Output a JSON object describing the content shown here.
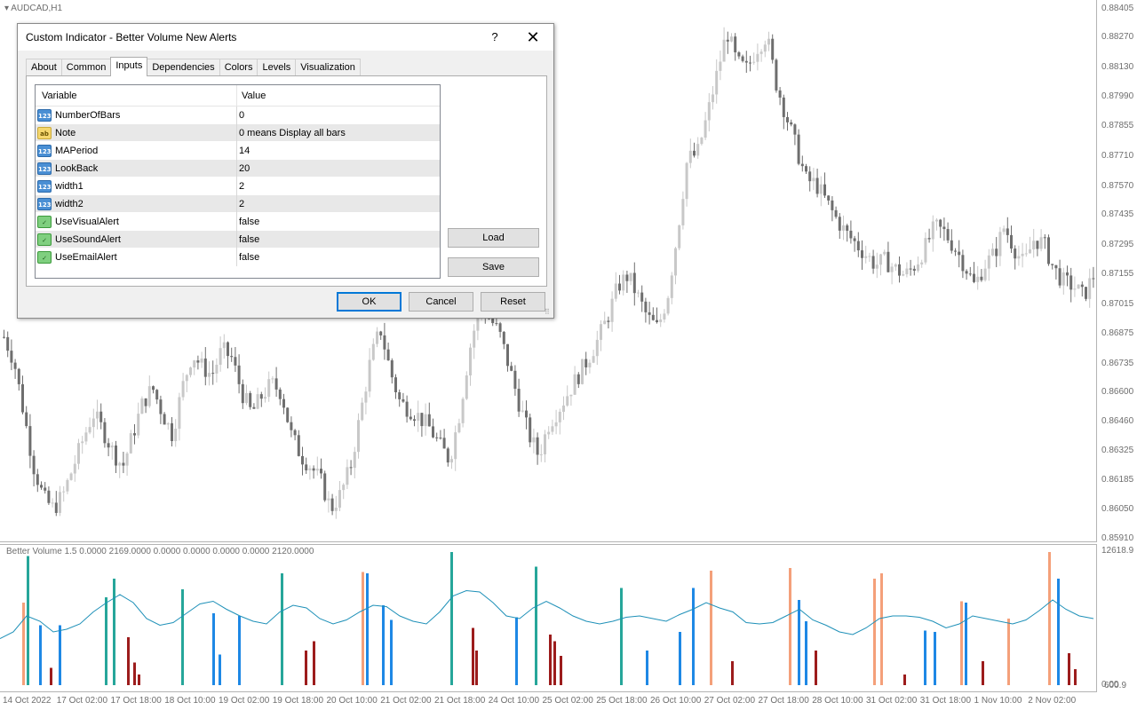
{
  "chart": {
    "symbol": "AUDCAD,H1",
    "bull_color": "#c8c8c8",
    "bear_color": "#6e6e6e",
    "price_ticks": [
      "0.88405",
      "0.88270",
      "0.88130",
      "0.87990",
      "0.87855",
      "0.87710",
      "0.87570",
      "0.87435",
      "0.87295",
      "0.87155",
      "0.87015",
      "0.86875",
      "0.86735",
      "0.86600",
      "0.86460",
      "0.86325",
      "0.86185",
      "0.86050",
      "0.85910"
    ],
    "time_ticks": [
      "14 Oct 2022",
      "17 Oct 02:00",
      "17 Oct 18:00",
      "18 Oct 10:00",
      "19 Oct 02:00",
      "19 Oct 18:00",
      "20 Oct 10:00",
      "21 Oct 02:00",
      "21 Oct 18:00",
      "24 Oct 10:00",
      "25 Oct 02:00",
      "25 Oct 18:00",
      "26 Oct 10:00",
      "27 Oct 02:00",
      "27 Oct 18:00",
      "28 Oct 10:00",
      "31 Oct 02:00",
      "31 Oct 18:00",
      "1 Nov 10:00",
      "2 Nov 02:00"
    ],
    "candle_path": [
      0.8686,
      0.8675,
      0.865,
      0.8625,
      0.861,
      0.8605,
      0.8612,
      0.8625,
      0.8638,
      0.865,
      0.8642,
      0.8632,
      0.8625,
      0.864,
      0.8655,
      0.8662,
      0.865,
      0.864,
      0.8662,
      0.8678,
      0.8672,
      0.8668,
      0.868,
      0.8676,
      0.866,
      0.865,
      0.8658,
      0.8664,
      0.866,
      0.864,
      0.863,
      0.8625,
      0.8618,
      0.8605,
      0.8612,
      0.8625,
      0.865,
      0.8675,
      0.869,
      0.867,
      0.8655,
      0.8652,
      0.8648,
      0.8643,
      0.8635,
      0.8628,
      0.865,
      0.868,
      0.87,
      0.8695,
      0.8688,
      0.8672,
      0.8655,
      0.864,
      0.863,
      0.8645,
      0.8652,
      0.866,
      0.8668,
      0.8676,
      0.8685,
      0.8696,
      0.871,
      0.8715,
      0.8705,
      0.8695,
      0.869,
      0.8705,
      0.8735,
      0.877,
      0.8772,
      0.879,
      0.881,
      0.883,
      0.8815,
      0.8812,
      0.8822,
      0.8828,
      0.8805,
      0.879,
      0.8775,
      0.876,
      0.8758,
      0.875,
      0.8742,
      0.8735,
      0.873,
      0.8725,
      0.872,
      0.8722,
      0.8718,
      0.8715,
      0.872,
      0.8728,
      0.8738,
      0.8735,
      0.8728,
      0.872,
      0.871,
      0.872,
      0.8725,
      0.8738,
      0.8728,
      0.872,
      0.8732,
      0.873,
      0.8718,
      0.8712,
      0.871,
      0.8705,
      0.8715
    ]
  },
  "indicator": {
    "label": "Better Volume 1.5 0.0000 2169.0000 0.0000 0.0000 0.0000 0.0000 2120.0000",
    "max_label": "12618.9",
    "zero_label": "0.00",
    "zero_label_2": "600.9",
    "colors": {
      "climax": "#26a69a",
      "churn": "#f4a07a",
      "lowvol": "#1e88e5",
      "high": "#9c1c1c",
      "ma": "#1e90b8"
    },
    "bars": [
      [
        25,
        "churn",
        0.62
      ],
      [
        30,
        "climax",
        0.97
      ],
      [
        44,
        "lowvol",
        0.45
      ],
      [
        56,
        "high",
        0.13
      ],
      [
        66,
        "lowvol",
        0.45
      ],
      [
        118,
        "climax",
        0.66
      ],
      [
        127,
        "climax",
        0.8
      ],
      [
        143,
        "high",
        0.36
      ],
      [
        150,
        "high",
        0.17
      ],
      [
        155,
        "high",
        0.08
      ],
      [
        204,
        "climax",
        0.72
      ],
      [
        239,
        "lowvol",
        0.54
      ],
      [
        246,
        "lowvol",
        0.23
      ],
      [
        268,
        "lowvol",
        0.52
      ],
      [
        316,
        "climax",
        0.84
      ],
      [
        343,
        "high",
        0.26
      ],
      [
        352,
        "high",
        0.33
      ],
      [
        407,
        "churn",
        0.85
      ],
      [
        412,
        "lowvol",
        0.84
      ],
      [
        430,
        "lowvol",
        0.6
      ],
      [
        439,
        "lowvol",
        0.49
      ],
      [
        507,
        "climax",
        1.0
      ],
      [
        531,
        "high",
        0.43
      ],
      [
        535,
        "high",
        0.26
      ],
      [
        580,
        "lowvol",
        0.51
      ],
      [
        602,
        "climax",
        0.89
      ],
      [
        618,
        "high",
        0.38
      ],
      [
        623,
        "high",
        0.33
      ],
      [
        630,
        "high",
        0.22
      ],
      [
        698,
        "climax",
        0.73
      ],
      [
        727,
        "lowvol",
        0.26
      ],
      [
        764,
        "lowvol",
        0.4
      ],
      [
        779,
        "lowvol",
        0.73
      ],
      [
        799,
        "churn",
        0.86
      ],
      [
        823,
        "high",
        0.18
      ],
      [
        888,
        "churn",
        0.88
      ],
      [
        898,
        "lowvol",
        0.64
      ],
      [
        906,
        "lowvol",
        0.48
      ],
      [
        917,
        "high",
        0.26
      ],
      [
        983,
        "churn",
        0.8
      ],
      [
        991,
        "churn",
        0.84
      ],
      [
        1017,
        "high",
        0.08
      ],
      [
        1040,
        "lowvol",
        0.41
      ],
      [
        1051,
        "lowvol",
        0.4
      ],
      [
        1081,
        "churn",
        0.63
      ],
      [
        1086,
        "lowvol",
        0.62
      ],
      [
        1105,
        "high",
        0.18
      ],
      [
        1134,
        "churn",
        0.5
      ],
      [
        1180,
        "churn",
        1.0
      ],
      [
        1190,
        "lowvol",
        0.8
      ],
      [
        1202,
        "high",
        0.24
      ],
      [
        1209,
        "high",
        0.12
      ]
    ],
    "ma_points": [
      [
        0,
        0.35
      ],
      [
        15,
        0.4
      ],
      [
        30,
        0.52
      ],
      [
        45,
        0.48
      ],
      [
        60,
        0.4
      ],
      [
        75,
        0.42
      ],
      [
        90,
        0.46
      ],
      [
        105,
        0.55
      ],
      [
        120,
        0.62
      ],
      [
        135,
        0.68
      ],
      [
        150,
        0.62
      ],
      [
        165,
        0.5
      ],
      [
        180,
        0.45
      ],
      [
        195,
        0.47
      ],
      [
        210,
        0.54
      ],
      [
        225,
        0.61
      ],
      [
        240,
        0.63
      ],
      [
        255,
        0.57
      ],
      [
        270,
        0.52
      ],
      [
        285,
        0.48
      ],
      [
        300,
        0.46
      ],
      [
        315,
        0.55
      ],
      [
        330,
        0.6
      ],
      [
        345,
        0.58
      ],
      [
        360,
        0.5
      ],
      [
        375,
        0.46
      ],
      [
        390,
        0.49
      ],
      [
        405,
        0.55
      ],
      [
        420,
        0.6
      ],
      [
        435,
        0.59
      ],
      [
        450,
        0.52
      ],
      [
        465,
        0.48
      ],
      [
        480,
        0.46
      ],
      [
        495,
        0.55
      ],
      [
        510,
        0.67
      ],
      [
        525,
        0.71
      ],
      [
        540,
        0.7
      ],
      [
        555,
        0.62
      ],
      [
        570,
        0.52
      ],
      [
        585,
        0.5
      ],
      [
        600,
        0.58
      ],
      [
        615,
        0.63
      ],
      [
        630,
        0.58
      ],
      [
        645,
        0.52
      ],
      [
        660,
        0.48
      ],
      [
        675,
        0.46
      ],
      [
        690,
        0.48
      ],
      [
        705,
        0.51
      ],
      [
        720,
        0.52
      ],
      [
        735,
        0.5
      ],
      [
        750,
        0.48
      ],
      [
        765,
        0.53
      ],
      [
        780,
        0.57
      ],
      [
        795,
        0.62
      ],
      [
        810,
        0.58
      ],
      [
        825,
        0.55
      ],
      [
        840,
        0.47
      ],
      [
        855,
        0.46
      ],
      [
        870,
        0.47
      ],
      [
        885,
        0.52
      ],
      [
        900,
        0.57
      ],
      [
        915,
        0.49
      ],
      [
        930,
        0.45
      ],
      [
        945,
        0.4
      ],
      [
        960,
        0.38
      ],
      [
        975,
        0.43
      ],
      [
        990,
        0.5
      ],
      [
        1005,
        0.52
      ],
      [
        1020,
        0.52
      ],
      [
        1035,
        0.51
      ],
      [
        1050,
        0.48
      ],
      [
        1065,
        0.43
      ],
      [
        1080,
        0.46
      ],
      [
        1095,
        0.52
      ],
      [
        1110,
        0.5
      ],
      [
        1125,
        0.48
      ],
      [
        1140,
        0.46
      ],
      [
        1155,
        0.49
      ],
      [
        1170,
        0.56
      ],
      [
        1185,
        0.64
      ],
      [
        1200,
        0.57
      ],
      [
        1215,
        0.52
      ],
      [
        1231,
        0.5
      ]
    ]
  },
  "dialog": {
    "title": "Custom Indicator - Better Volume New Alerts",
    "help_glyph": "?",
    "close_glyph": "✕",
    "tabs": [
      "About",
      "Common",
      "Inputs",
      "Dependencies",
      "Colors",
      "Levels",
      "Visualization"
    ],
    "active_tab": "Inputs",
    "table_headers": {
      "variable": "Variable",
      "value": "Value"
    },
    "inputs": [
      {
        "name": "NumberOfBars",
        "value": "0",
        "type": "int",
        "icon_text": "123"
      },
      {
        "name": "Note",
        "value": "0 means Display all bars",
        "type": "str",
        "icon_text": "ab"
      },
      {
        "name": "MAPeriod",
        "value": "14",
        "type": "int",
        "icon_text": "123"
      },
      {
        "name": "LookBack",
        "value": "20",
        "type": "int",
        "icon_text": "123"
      },
      {
        "name": "width1",
        "value": "2",
        "type": "int",
        "icon_text": "123"
      },
      {
        "name": "width2",
        "value": "2",
        "type": "int",
        "icon_text": "123"
      },
      {
        "name": "UseVisualAlert",
        "value": "false",
        "type": "bool",
        "icon_text": "✓"
      },
      {
        "name": "UseSoundAlert",
        "value": "false",
        "type": "bool",
        "icon_text": "✓"
      },
      {
        "name": "UseEmailAlert",
        "value": "false",
        "type": "bool",
        "icon_text": "✓"
      }
    ],
    "buttons": {
      "load": "Load",
      "save": "Save",
      "ok": "OK",
      "cancel": "Cancel",
      "reset": "Reset"
    },
    "grip_glyph": "⠿"
  }
}
